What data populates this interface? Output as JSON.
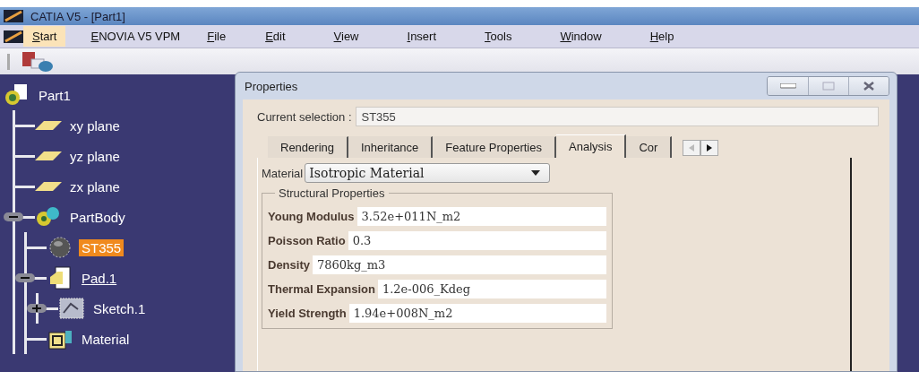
{
  "window": {
    "title": "CATIA V5 - [Part1]"
  },
  "menu": [
    {
      "label": "Start",
      "selected": true
    },
    {
      "label": "ENOVIA V5 VPM",
      "selected": false
    },
    {
      "label": "File",
      "selected": false
    },
    {
      "label": "Edit",
      "selected": false
    },
    {
      "label": "View",
      "selected": false
    },
    {
      "label": "Insert",
      "selected": false
    },
    {
      "label": "Tools",
      "selected": false
    },
    {
      "label": "Window",
      "selected": false
    },
    {
      "label": "Help",
      "selected": false
    }
  ],
  "tree": [
    {
      "label": "Part1",
      "kind": "part",
      "selected": false,
      "children": [
        {
          "label": "xy plane",
          "kind": "plane",
          "selected": false
        },
        {
          "label": "yz plane",
          "kind": "plane",
          "selected": false
        },
        {
          "label": "zx plane",
          "kind": "plane",
          "selected": false
        },
        {
          "label": "PartBody",
          "kind": "body",
          "selected": false,
          "expanded": true,
          "children": [
            {
              "label": "ST355",
              "kind": "sphere",
              "selected": true
            },
            {
              "label": "Pad.1",
              "kind": "pad",
              "selected": false,
              "expanded": true,
              "children": [
                {
                  "label": "Sketch.1",
                  "kind": "sketch",
                  "selected": false,
                  "expanded": false
                }
              ]
            },
            {
              "label": "Material",
              "kind": "material",
              "selected": false
            }
          ]
        }
      ]
    }
  ],
  "dialog": {
    "title": "Properties",
    "current_selection": {
      "label": "Current selection :",
      "value": "ST355"
    },
    "tabs": [
      {
        "label": "Rendering",
        "selected": false
      },
      {
        "label": "Inheritance",
        "selected": false
      },
      {
        "label": "Feature Properties",
        "selected": false
      },
      {
        "label": "Analysis",
        "selected": true
      },
      {
        "label": "Cor",
        "selected": false
      }
    ],
    "material": {
      "label": "Material",
      "value": "Isotropic Material"
    },
    "group": {
      "title": "Structural Properties",
      "fields": [
        {
          "label": "Young Modulus",
          "value": "3.52e+011N_m2"
        },
        {
          "label": "Poisson Ratio",
          "value": "0.3"
        },
        {
          "label": "Density",
          "value": "7860kg_m3"
        },
        {
          "label": "Thermal Expansion",
          "value": "1.2e-006_Kdeg"
        },
        {
          "label": "Yield Strength",
          "value": "1.94e+008N_m2"
        }
      ]
    }
  }
}
